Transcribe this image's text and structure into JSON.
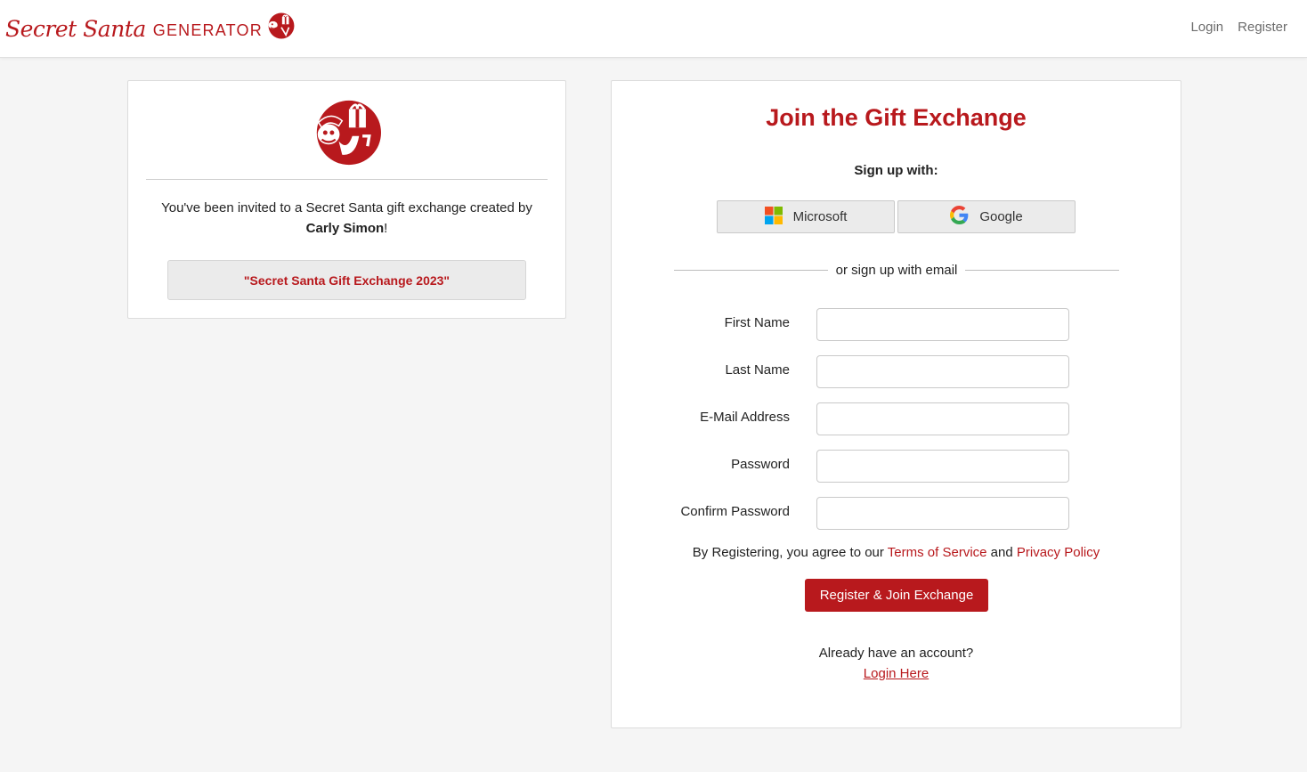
{
  "brand": {
    "script_text": "Secret Santa",
    "caps_text": "GENERATOR",
    "logo_icon": "santa-gift-logo-icon"
  },
  "nav": {
    "login_label": "Login",
    "register_label": "Register"
  },
  "invite": {
    "logo_icon": "santa-gift-logo-icon",
    "text_prefix": "You've been invited to a Secret Santa gift exchange created by",
    "creator_name": "Carly Simon",
    "text_suffix": "!",
    "exchange_name": "\"Secret Santa Gift Exchange 2023\""
  },
  "join": {
    "title": "Join the Gift Exchange",
    "signup_with_label": "Sign up with:",
    "sso": [
      {
        "label": "Microsoft",
        "icon": "microsoft-icon"
      },
      {
        "label": "Google",
        "icon": "google-icon"
      }
    ],
    "divider_text": "or sign up with email",
    "fields": [
      {
        "label": "First Name",
        "value": ""
      },
      {
        "label": "Last Name",
        "value": ""
      },
      {
        "label": "E-Mail Address",
        "value": ""
      },
      {
        "label": "Password",
        "value": ""
      },
      {
        "label": "Confirm Password",
        "value": ""
      }
    ],
    "terms_prefix": "By Registering, you agree to our",
    "terms_link": "Terms of Service",
    "terms_and": "and",
    "privacy_link": "Privacy Policy",
    "submit_label": "Register & Join Exchange",
    "already_text": "Already have an account?",
    "login_link": "Login Here"
  },
  "colors": {
    "brand_red": "#b8191d",
    "page_bg": "#f5f5f5",
    "button_gray": "#ebebeb"
  }
}
